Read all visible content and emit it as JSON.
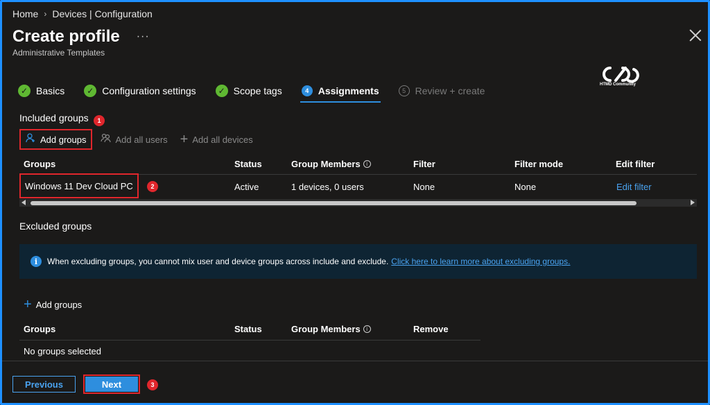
{
  "breadcrumb": {
    "home": "Home",
    "section": "Devices | Configuration"
  },
  "header": {
    "title": "Create profile",
    "more": "···",
    "subtitle": "Administrative Templates"
  },
  "logo": {
    "text": "HTMD Community"
  },
  "steps": [
    {
      "label": "Basics",
      "state": "done"
    },
    {
      "label": "Configuration settings",
      "state": "done"
    },
    {
      "label": "Scope tags",
      "state": "done"
    },
    {
      "label": "Assignments",
      "state": "active",
      "number": "4"
    },
    {
      "label": "Review + create",
      "state": "disabled",
      "number": "5"
    }
  ],
  "included": {
    "label": "Included groups",
    "badge": "1",
    "toolbar": {
      "add_groups": "Add groups",
      "add_all_users": "Add all users",
      "add_all_devices": "Add all devices"
    },
    "columns": {
      "groups": "Groups",
      "status": "Status",
      "members": "Group Members",
      "filter": "Filter",
      "filter_mode": "Filter mode",
      "edit_filter": "Edit filter"
    },
    "rows": [
      {
        "group": "Windows 11 Dev Cloud PC",
        "badge": "2",
        "status": "Active",
        "members": "1 devices, 0 users",
        "filter": "None",
        "filter_mode": "None",
        "edit_filter": "Edit filter"
      }
    ]
  },
  "excluded": {
    "label": "Excluded groups",
    "info_text": "When excluding groups, you cannot mix user and device groups across include and exclude.",
    "info_link": "Click here to learn more about excluding groups.",
    "add_groups": "Add groups",
    "columns": {
      "groups": "Groups",
      "status": "Status",
      "members": "Group Members",
      "remove": "Remove"
    },
    "empty": "No groups selected"
  },
  "footer": {
    "previous": "Previous",
    "next": "Next",
    "badge": "3"
  },
  "colors": {
    "accent": "#2e8ede",
    "success": "#5fb832",
    "highlight": "#e0262c",
    "frame": "#1e90ff"
  }
}
